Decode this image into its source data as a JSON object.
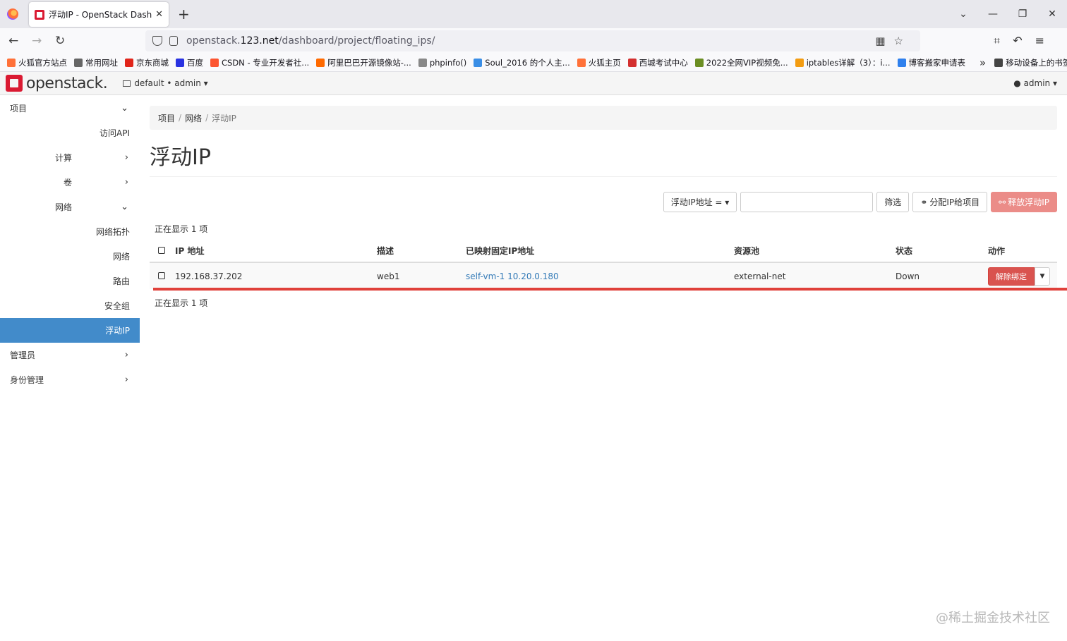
{
  "browser": {
    "tab_title": "浮动IP - OpenStack Dashboard",
    "url_prefix": "openstack.",
    "url_host": "123.net",
    "url_path": "/dashboard/project/floating_ips/",
    "bookmarks": [
      {
        "label": "火狐官方站点",
        "color": "#ff7139"
      },
      {
        "label": "常用网址",
        "color": "#666666"
      },
      {
        "label": "京东商城",
        "color": "#e1251b"
      },
      {
        "label": "百度",
        "color": "#2932e1"
      },
      {
        "label": "CSDN - 专业开发者社...",
        "color": "#fc5531"
      },
      {
        "label": "阿里巴巴开源镜像站-...",
        "color": "#ff6a00"
      },
      {
        "label": "phpinfo()",
        "color": "#888888"
      },
      {
        "label": "Soul_2016 的个人主...",
        "color": "#3a8ee6"
      },
      {
        "label": "火狐主页",
        "color": "#ff7139"
      },
      {
        "label": "西城考试中心",
        "color": "#d32f2f"
      },
      {
        "label": "2022全网VIP视频免...",
        "color": "#6b8e23"
      },
      {
        "label": "iptables详解（3）：i...",
        "color": "#f39c12"
      },
      {
        "label": "博客搬家申请表",
        "color": "#2f80ed"
      },
      {
        "label": "移动设备上的书签",
        "color": "#444444"
      }
    ]
  },
  "header": {
    "logo": "openstack.",
    "project": "default • admin ▾",
    "user": "admin ▾"
  },
  "sidebar": {
    "project": "项目",
    "api": "访问API",
    "compute": "计算",
    "volumes": "卷",
    "network": "网络",
    "topology": "网络拓扑",
    "networks": "网络",
    "routers": "路由",
    "security_groups": "安全组",
    "floating_ips": "浮动IP",
    "admin": "管理员",
    "identity": "身份管理"
  },
  "breadcrumb": [
    "项目",
    "网络",
    "浮动IP"
  ],
  "page_title": "浮动IP",
  "toolbar": {
    "filter_select": "浮动IP地址 = ▾",
    "filter_btn": "筛选",
    "allocate_btn": "分配IP给项目",
    "release_btn": "释放浮动IP"
  },
  "table": {
    "count_text": "正在显示 1 项",
    "headers": [
      "IP 地址",
      "描述",
      "已映射固定IP地址",
      "资源池",
      "状态",
      "动作"
    ],
    "rows": [
      {
        "ip": "192.168.37.202",
        "desc": "web1",
        "mapped": "self-vm-1 10.20.0.180",
        "pool": "external-net",
        "status": "Down",
        "action": "解除绑定"
      }
    ]
  },
  "watermark": "@稀土掘金技术社区"
}
